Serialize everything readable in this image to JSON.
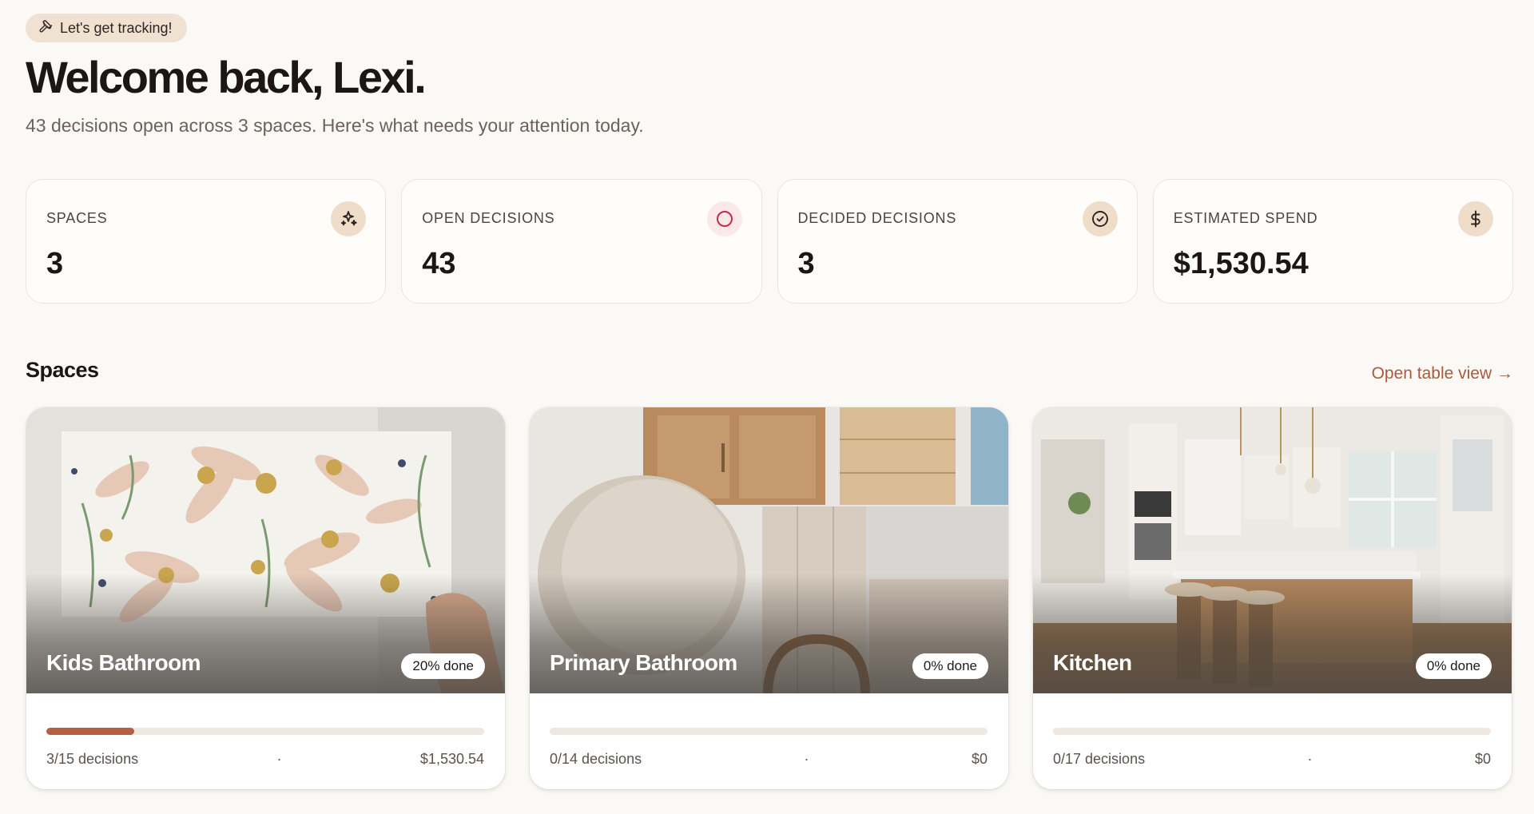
{
  "header": {
    "pill_label": "Let's get tracking!",
    "pill_icon": "hammer-icon",
    "title": "Welcome back, Lexi.",
    "subtitle": "43 decisions open across 3 spaces. Here's what needs your attention today."
  },
  "stats": [
    {
      "label": "SPACES",
      "value": "3",
      "icon": "sparkles-icon"
    },
    {
      "label": "OPEN DECISIONS",
      "value": "43",
      "icon": "circle-icon"
    },
    {
      "label": "DECIDED DECISIONS",
      "value": "3",
      "icon": "check-circle-icon"
    },
    {
      "label": "ESTIMATED SPEND",
      "value": "$1,530.54",
      "icon": "dollar-icon"
    }
  ],
  "spaces_section": {
    "title": "Spaces",
    "table_link": "Open table view →"
  },
  "spaces": [
    {
      "name": "Kids Bathroom",
      "done_label": "20% done",
      "progress": 0.2,
      "decisions": "3/15 decisions",
      "separator": "·",
      "spend": "$1,530.54",
      "image": "floral-tile-photo"
    },
    {
      "name": "Primary Bathroom",
      "done_label": "0% done",
      "progress": 0,
      "decisions": "0/14 decisions",
      "separator": "·",
      "spend": "$0",
      "image": "material-moodboard-photo"
    },
    {
      "name": "Kitchen",
      "done_label": "0% done",
      "progress": 0,
      "decisions": "0/17 decisions",
      "separator": "·",
      "spend": "$0",
      "image": "kitchen-photo"
    }
  ],
  "colors": {
    "background": "#fbf9f6",
    "accent": "#b55e43",
    "link": "#a95a3e",
    "pill_bg": "#f0e1d2"
  }
}
